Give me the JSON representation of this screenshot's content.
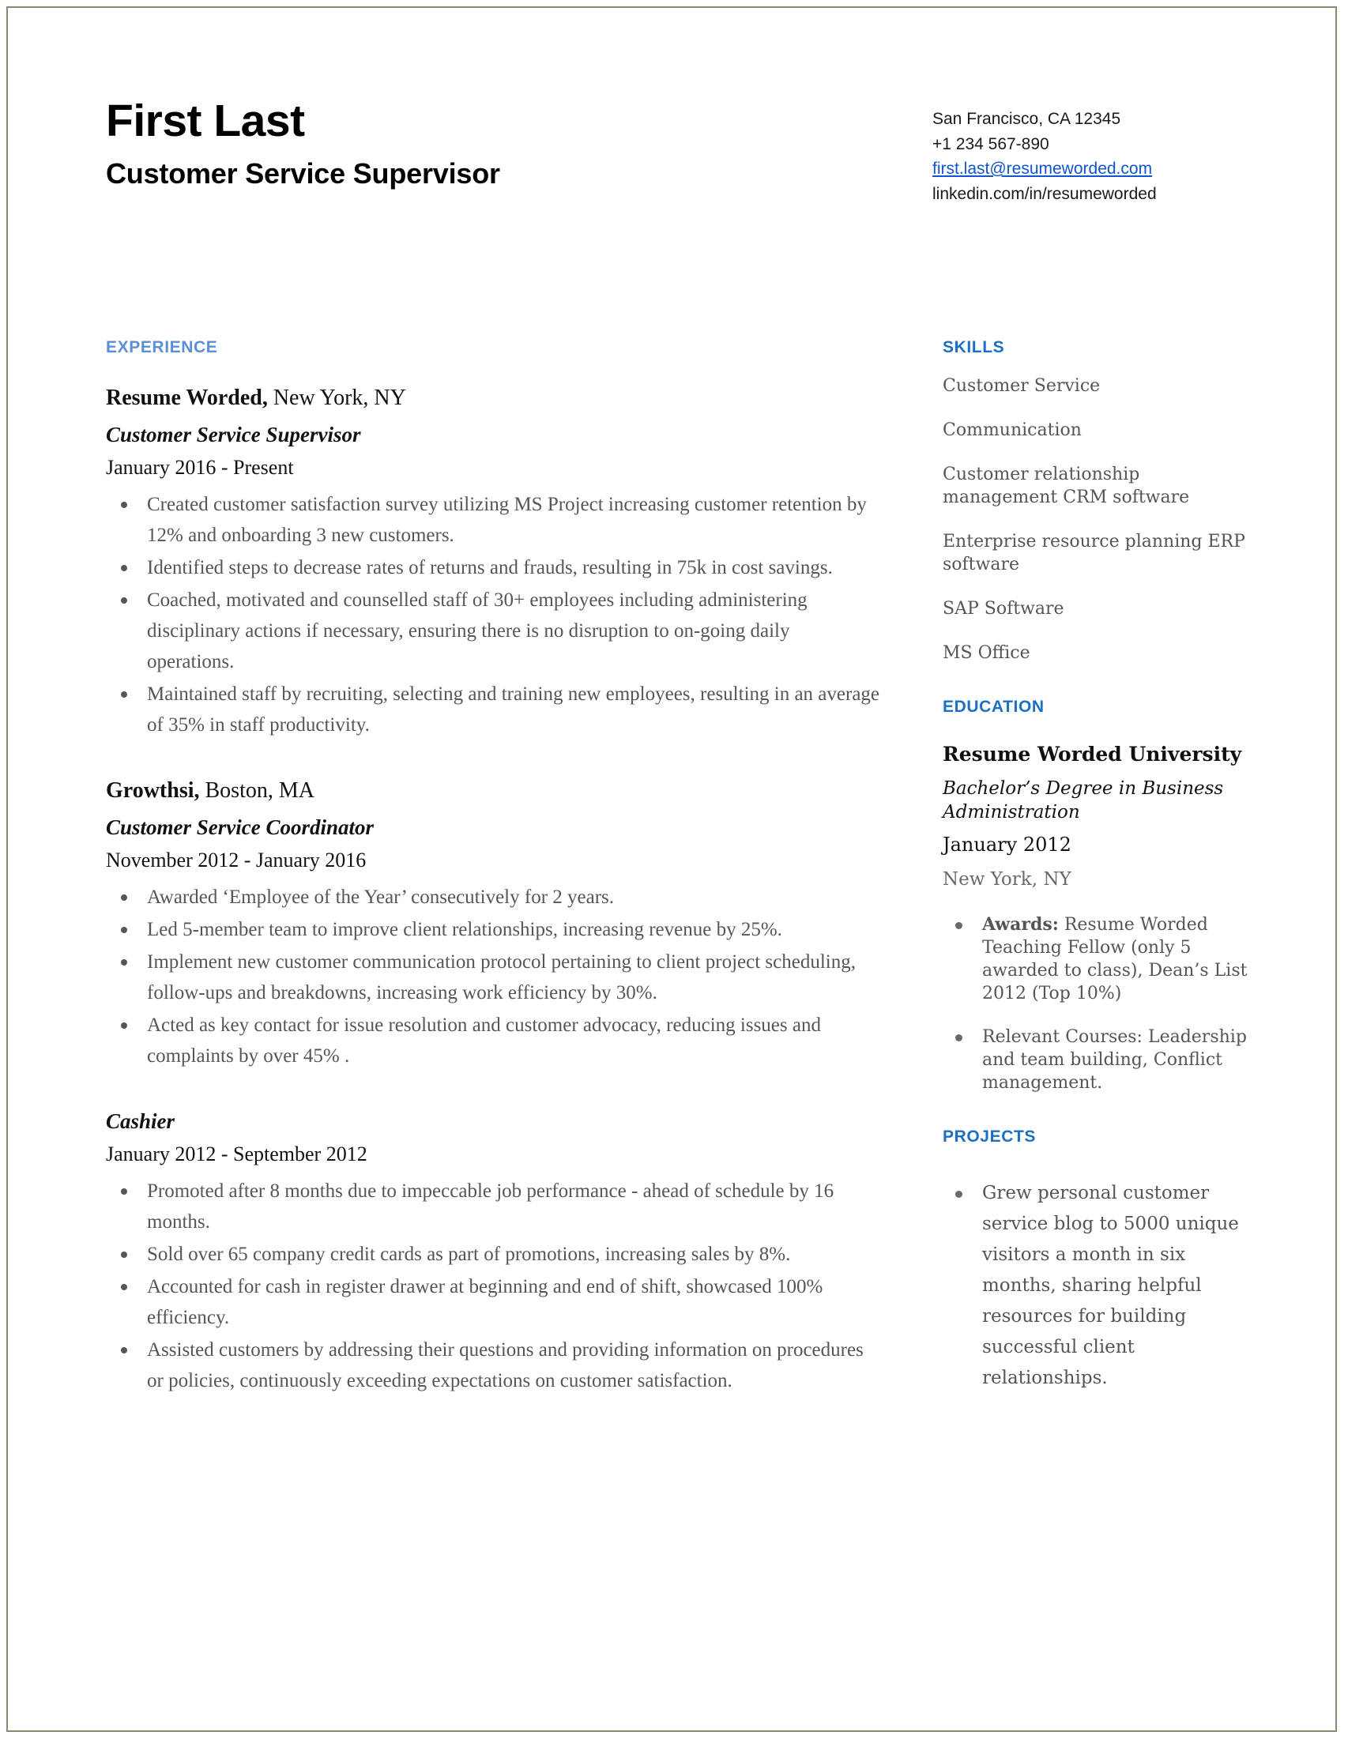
{
  "header": {
    "name": "First Last",
    "headline": "Customer Service Supervisor",
    "contact": {
      "location": "San Francisco, CA 12345",
      "phone": "+1 234 567-890",
      "email": "first.last@resumeworded.com",
      "linkedin": "linkedin.com/in/resumeworded"
    }
  },
  "colors": {
    "heading_light_blue": "#5b8fd9",
    "heading_blue": "#1b6fc4",
    "link_blue": "#1155cc",
    "body_text": "#565656",
    "border": "#8a8a6e"
  },
  "main": {
    "experience_heading": "EXPERIENCE",
    "jobs": [
      {
        "company": "Resume Worded,",
        "location": " New York, NY",
        "title": "Customer Service Supervisor",
        "dates": "January 2016 - Present",
        "bullets": [
          "Created customer satisfaction survey utilizing MS Project increasing customer retention by 12% and onboarding 3 new customers.",
          "Identified steps to decrease rates of returns and frauds, resulting in 75k in cost savings.",
          "Coached, motivated and counselled staff of 30+ employees including administering disciplinary actions if necessary,  ensuring there is no disruption to on-going daily operations.",
          "Maintained staff by recruiting, selecting and training new employees, resulting in an average of 35% in staff productivity."
        ]
      },
      {
        "company": "Growthsi,",
        "location": " Boston, MA",
        "title": "Customer Service Coordinator",
        "dates": "November 2012 - January 2016",
        "bullets": [
          "Awarded ‘Employee of the Year’ consecutively for 2 years.",
          "Led 5-member team to improve client relationships, increasing revenue by 25%.",
          "Implement new customer communication protocol pertaining to client project scheduling, follow-ups and breakdowns, increasing work efficiency by 30%.",
          "Acted as key contact for issue resolution and customer advocacy, reducing issues and complaints by over 45% ."
        ]
      },
      {
        "company": "",
        "location": "",
        "title": "Cashier",
        "dates": "January 2012 - September 2012",
        "bullets": [
          "Promoted after 8 months due to impeccable job performance - ahead of schedule by 16 months.",
          "Sold over 65 company credit cards as part of promotions, increasing sales by 8%.",
          "Accounted for cash in register drawer at beginning and end of shift, showcased 100% efficiency.",
          "Assisted customers by addressing their questions and providing information on procedures or policies, continuously exceeding expectations on customer satisfaction."
        ]
      }
    ]
  },
  "sidebar": {
    "skills_heading": "SKILLS",
    "skills": [
      "Customer Service",
      "Communication",
      "Customer relationship management CRM software",
      "Enterprise resource planning ERP software",
      "SAP Software",
      "MS Office"
    ],
    "education_heading": "EDUCATION",
    "education": {
      "school": "Resume Worded University",
      "degree": "Bachelor’s Degree in Business Administration",
      "date": "January 2012",
      "location": "New York, NY",
      "bullets": [
        {
          "label": "Awards:",
          "text": " Resume Worded Teaching Fellow (only 5 awarded to class), Dean’s List 2012 (Top 10%)"
        },
        {
          "label": "",
          "text": "Relevant Courses: Leadership and team building, Conflict management."
        }
      ]
    },
    "projects_heading": "PROJECTS",
    "projects": [
      "Grew personal customer service  blog to 5000 unique visitors a month in six months, sharing helpful resources for building successful client relationships."
    ]
  }
}
